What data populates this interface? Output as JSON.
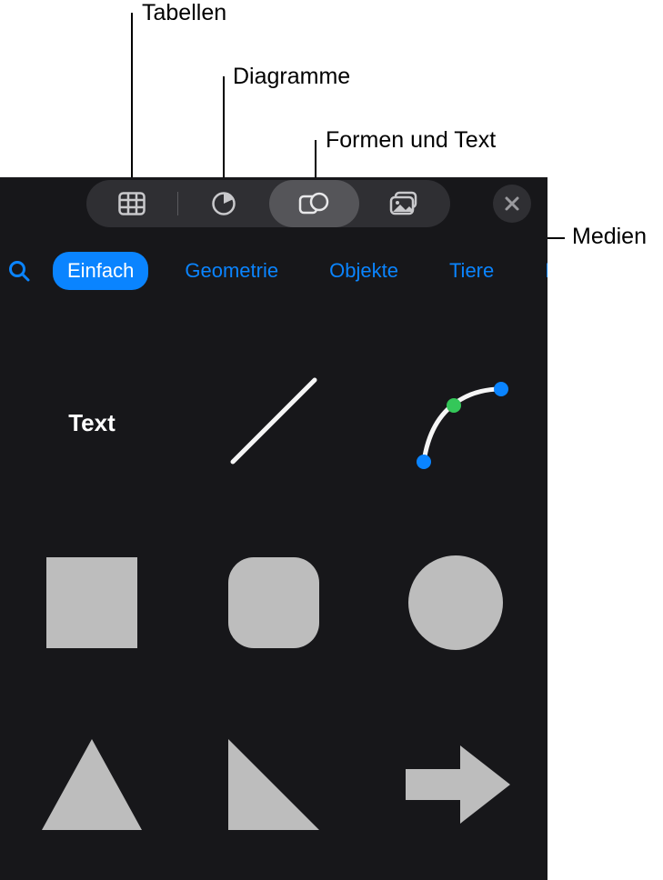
{
  "callouts": {
    "tables": "Tabellen",
    "charts": "Diagramme",
    "shapes_text": "Formen und Text",
    "media": "Medien"
  },
  "segments": {
    "tables_icon": "table-icon",
    "charts_icon": "pie-chart-icon",
    "shapes_icon": "shapes-icon",
    "media_icon": "image-stack-icon"
  },
  "categories": {
    "einfach": "Einfach",
    "geometrie": "Geometrie",
    "objekte": "Objekte",
    "tiere": "Tiere",
    "next_partial": "N"
  },
  "grid": {
    "text_label": "Text"
  }
}
